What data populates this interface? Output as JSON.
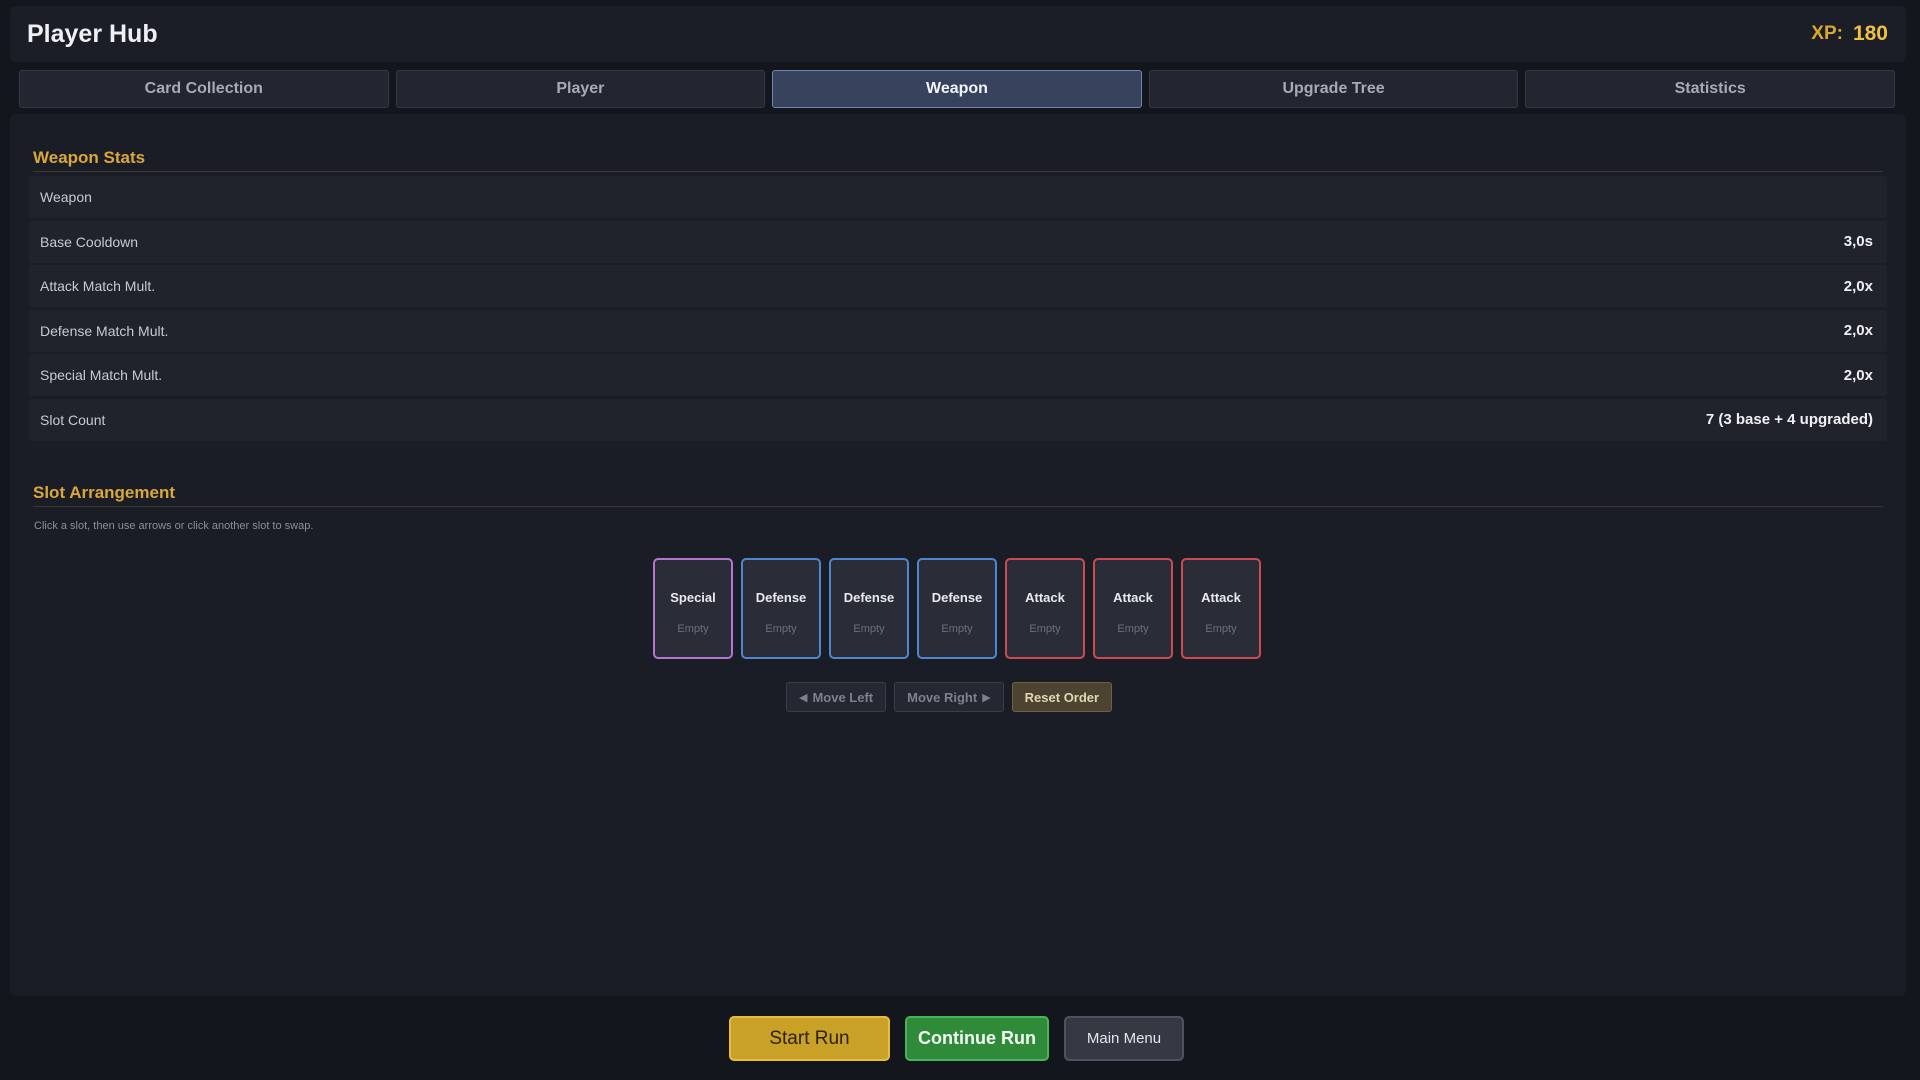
{
  "header": {
    "title": "Player Hub",
    "xp_label": "XP:",
    "xp_value": "180"
  },
  "tabs": [
    {
      "label": "Card Collection"
    },
    {
      "label": "Player"
    },
    {
      "label": "Weapon"
    },
    {
      "label": "Upgrade Tree"
    },
    {
      "label": "Statistics"
    }
  ],
  "active_tab": "Weapon",
  "weapon_stats": {
    "title": "Weapon Stats",
    "rows": [
      {
        "label": "Weapon",
        "value": ""
      },
      {
        "label": "Base Cooldown",
        "value": "3,0s"
      },
      {
        "label": "Attack Match Mult.",
        "value": "2,0x"
      },
      {
        "label": "Defense Match Mult.",
        "value": "2,0x"
      },
      {
        "label": "Special Match Mult.",
        "value": "2,0x"
      },
      {
        "label": "Slot Count",
        "value": "7 (3 base + 4 upgraded)"
      }
    ]
  },
  "slot_arrangement": {
    "title": "Slot Arrangement",
    "hint": "Click a slot, then use arrows or click another slot to swap.",
    "slots": [
      {
        "type": "Special",
        "state": "Empty",
        "color": "#b674d4"
      },
      {
        "type": "Defense",
        "state": "Empty",
        "color": "#4f86cf"
      },
      {
        "type": "Defense",
        "state": "Empty",
        "color": "#4f86cf"
      },
      {
        "type": "Defense",
        "state": "Empty",
        "color": "#4f86cf"
      },
      {
        "type": "Attack",
        "state": "Empty",
        "color": "#cf4a50"
      },
      {
        "type": "Attack",
        "state": "Empty",
        "color": "#cf4a50"
      },
      {
        "type": "Attack",
        "state": "Empty",
        "color": "#cf4a50"
      }
    ],
    "controls": {
      "move_left": "Move Left",
      "move_right": "Move Right",
      "reset": "Reset Order"
    }
  },
  "bottom": {
    "start_run": "Start Run",
    "continue_run": "Continue Run",
    "main_menu": "Main Menu"
  },
  "colors": {
    "accent_gold": "#f0c040",
    "active_tab": "#37425c",
    "start_button": "#c9a127",
    "continue_button": "#2f8a3a"
  }
}
